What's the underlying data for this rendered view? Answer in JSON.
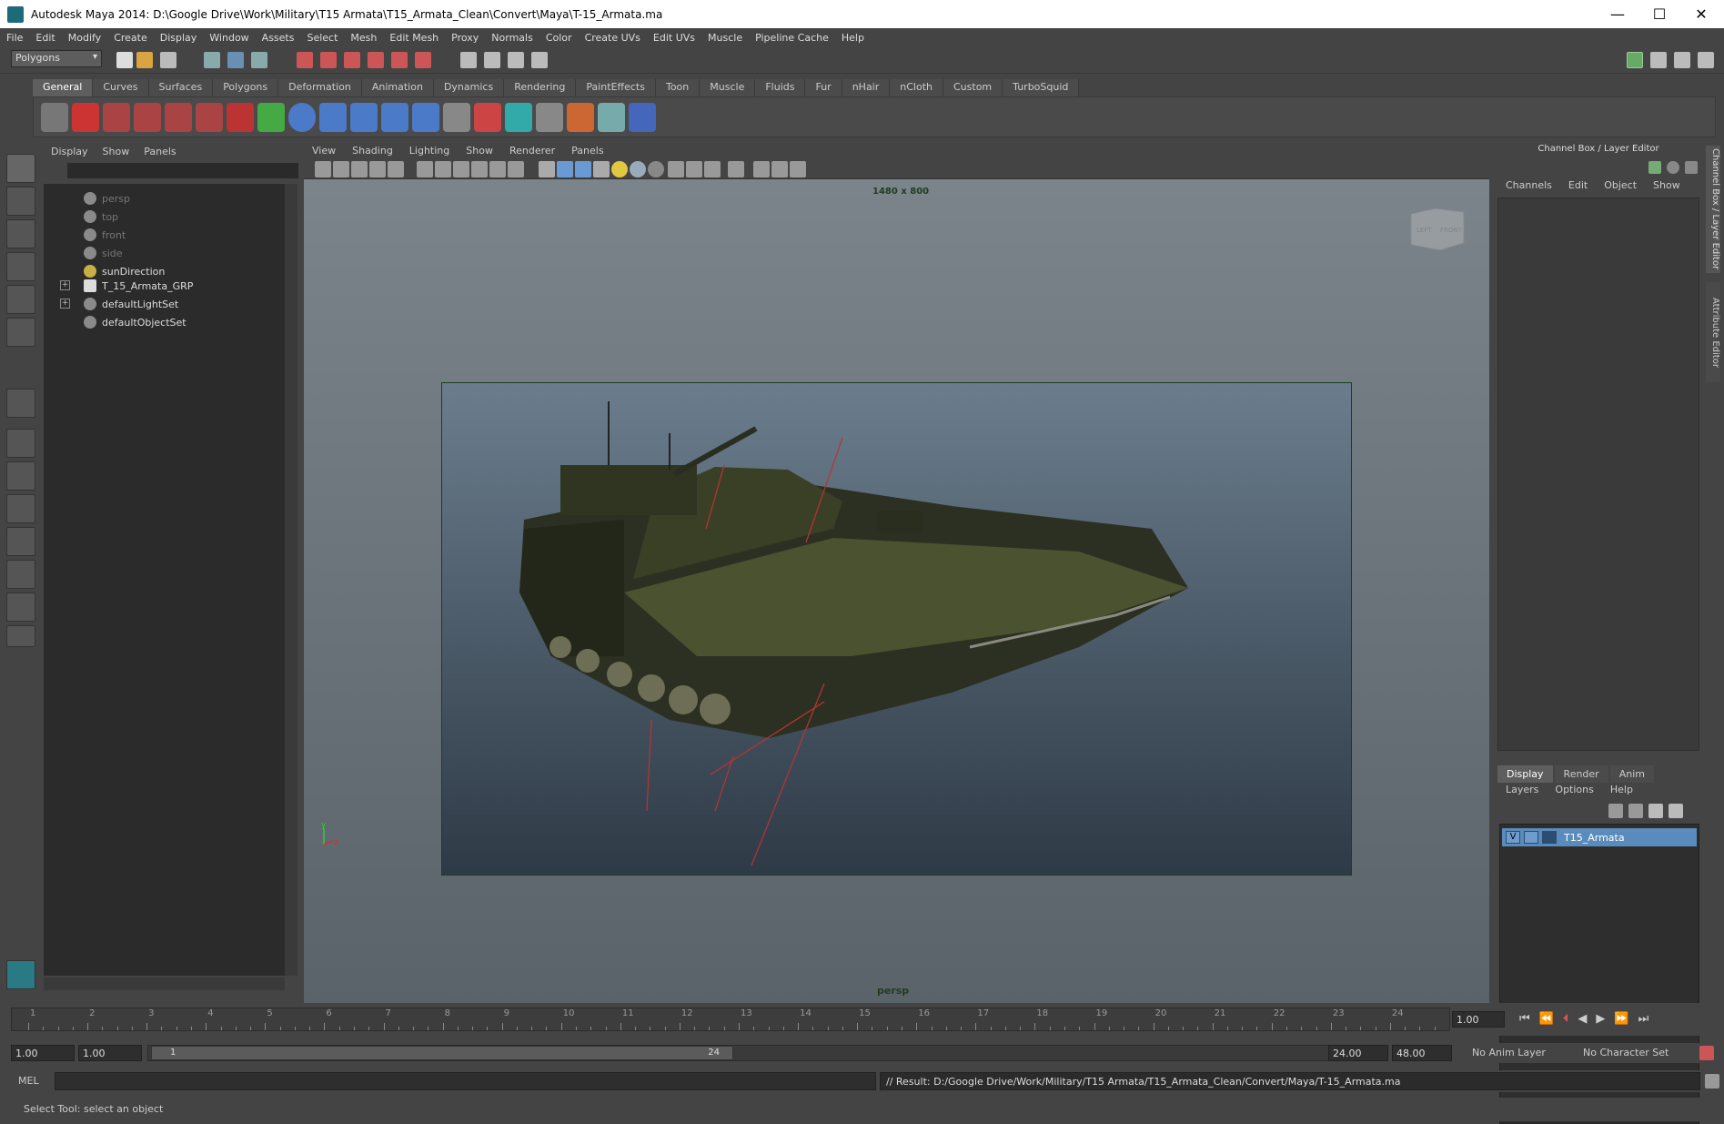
{
  "window": {
    "title": "Autodesk Maya 2014: D:\\Google Drive\\Work\\Military\\T15 Armata\\T15_Armata_Clean\\Convert\\Maya\\T-15_Armata.ma",
    "minimize": "—",
    "maximize": "☐",
    "close": "✕"
  },
  "menubar": [
    "File",
    "Edit",
    "Modify",
    "Create",
    "Display",
    "Window",
    "Assets",
    "Select",
    "Mesh",
    "Edit Mesh",
    "Proxy",
    "Normals",
    "Color",
    "Create UVs",
    "Edit UVs",
    "Muscle",
    "Pipeline Cache",
    "Help"
  ],
  "mode_selector": "Polygons",
  "shelf_tabs": [
    "General",
    "Curves",
    "Surfaces",
    "Polygons",
    "Deformation",
    "Animation",
    "Dynamics",
    "Rendering",
    "PaintEffects",
    "Toon",
    "Muscle",
    "Fluids",
    "Fur",
    "nHair",
    "nCloth",
    "Custom",
    "TurboSquid"
  ],
  "active_shelf_tab": "General",
  "outliner": {
    "menu": [
      "Display",
      "Show",
      "Panels"
    ],
    "items": [
      {
        "label": "persp",
        "dim": true
      },
      {
        "label": "top",
        "dim": true
      },
      {
        "label": "front",
        "dim": true
      },
      {
        "label": "side",
        "dim": true
      },
      {
        "label": "sunDirection",
        "dim": false
      },
      {
        "label": "T_15_Armata_GRP",
        "dim": false
      },
      {
        "label": "defaultLightSet",
        "dim": false
      },
      {
        "label": "defaultObjectSet",
        "dim": false
      }
    ]
  },
  "viewport": {
    "menu": [
      "View",
      "Shading",
      "Lighting",
      "Show",
      "Renderer",
      "Panels"
    ],
    "resolution_label": "1480 x 800",
    "camera_label": "persp",
    "viewcube_left": "LEFT",
    "viewcube_front": "FRONT",
    "axis_y": "y",
    "axis_x": "z"
  },
  "channel_box": {
    "title": "Channel Box / Layer Editor",
    "menu": [
      "Channels",
      "Edit",
      "Object",
      "Show"
    ],
    "side_tab_1": "Channel Box / Layer Editor",
    "side_tab_2": "Attribute Editor"
  },
  "layer_editor": {
    "tabs": [
      "Display",
      "Render",
      "Anim"
    ],
    "menu": [
      "Layers",
      "Options",
      "Help"
    ],
    "layer_visibility": "V",
    "layer_name": "T15_Armata"
  },
  "timeline": {
    "ticks": [
      "1",
      "2",
      "3",
      "4",
      "5",
      "6",
      "7",
      "8",
      "9",
      "10",
      "11",
      "12",
      "13",
      "14",
      "15",
      "16",
      "17",
      "18",
      "19",
      "20",
      "21",
      "22",
      "23",
      "24"
    ],
    "current_frame": "1.00"
  },
  "range": {
    "start": "1.00",
    "playback_start": "1.00",
    "slider_start": "1",
    "slider_end": "24",
    "playback_end": "24.00",
    "end": "48.00",
    "anim_layer": "No Anim Layer",
    "character_set": "No Character Set"
  },
  "command_line": {
    "language": "MEL",
    "result": "// Result: D:/Google Drive/Work/Military/T15 Armata/T15_Armata_Clean/Convert/Maya/T-15_Armata.ma"
  },
  "help_line": "Select Tool: select an object"
}
